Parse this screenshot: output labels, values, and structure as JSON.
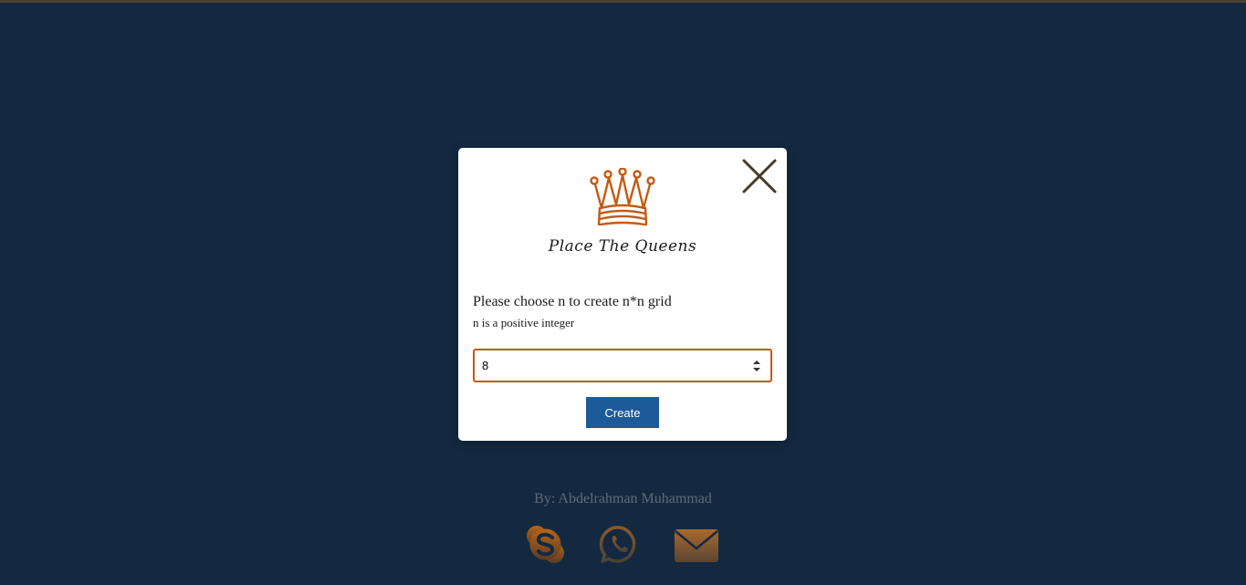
{
  "app": {
    "title": "Place The Queens",
    "accent_color": "#c45a12",
    "background_color": "#142940"
  },
  "modal": {
    "prompt": "Please choose n to create n*n grid",
    "hint": "n is a positive integer",
    "input_value": "8",
    "create_label": "Create",
    "close_icon": "close-icon",
    "logo_icon": "crown-icon"
  },
  "footer": {
    "author": "By: Abdelrahman Muhammad",
    "social": [
      {
        "icon": "skype-icon"
      },
      {
        "icon": "whatsapp-icon"
      },
      {
        "icon": "mail-icon"
      }
    ]
  }
}
